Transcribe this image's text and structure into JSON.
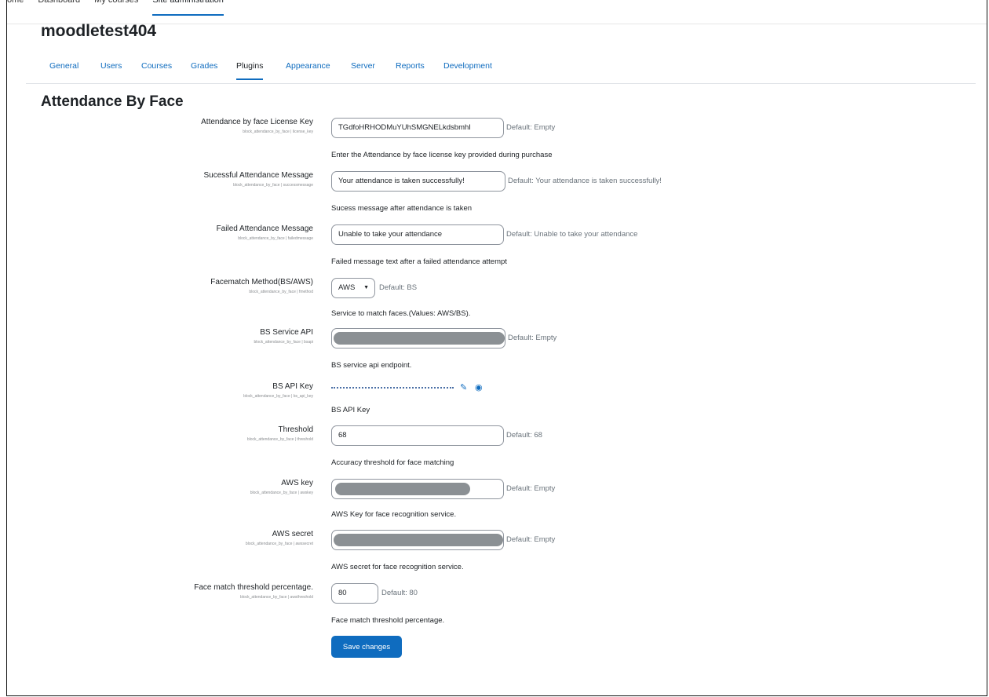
{
  "topnav": [
    "Home",
    "Dashboard",
    "My courses",
    "Site administration"
  ],
  "site_name": "moodletest404",
  "secnav": [
    "General",
    "Users",
    "Courses",
    "Grades",
    "Plugins",
    "Appearance",
    "Server",
    "Reports",
    "Development"
  ],
  "page_title": "Attendance By Face",
  "settings": [
    {
      "label": "Attendance by face License Key",
      "sub": "block_attendance_by_face | license_key",
      "value": "TGdfoHRHODMuYUhSMGNELkdsbmhI",
      "default": "Default: Empty",
      "desc": "Enter the Attendance by face license key provided during purchase"
    },
    {
      "label": "Sucessful Attendance Message",
      "sub": "block_attendance_by_face | successmessage",
      "value": "Your attendance is taken successfully!",
      "default": "Default: Your attendance is taken successfully!",
      "desc": "Sucess message after attendance is taken"
    },
    {
      "label": "Failed Attendance Message",
      "sub": "block_attendance_by_face | failedmessage",
      "value": "Unable to take your attendance",
      "default": "Default: Unable to take your attendance",
      "desc": "Failed message text after a failed attendance attempt"
    },
    {
      "label": "Facematch Method(BS/AWS)",
      "sub": "block_attendance_by_face | fmethod",
      "value": "AWS",
      "default": "Default: BS",
      "desc": "Service to match faces.(Values: AWS/BS)."
    },
    {
      "label": "BS Service API",
      "sub": "block_attendance_by_face | bsapi",
      "value": "",
      "default": "Default: Empty",
      "desc": "BS service api endpoint."
    },
    {
      "label": "BS API Key",
      "sub": "block_attendance_by_face | bs_api_key",
      "value": "",
      "default": "",
      "desc": "BS API Key"
    },
    {
      "label": "Threshold",
      "sub": "block_attendance_by_face | threshold",
      "value": "68",
      "default": "Default: 68",
      "desc": "Accuracy threshold for face matching"
    },
    {
      "label": "AWS key",
      "sub": "block_attendance_by_face | awskey",
      "value": "",
      "default": "Default: Empty",
      "desc": "AWS Key for face recognition service."
    },
    {
      "label": "AWS secret",
      "sub": "block_attendance_by_face | awssecret",
      "value": "",
      "default": "Default: Empty",
      "desc": "AWS secret for face recognition service."
    },
    {
      "label": "Face match threshold percentage.",
      "sub": "block_attendance_by_face | awsthreshold",
      "value": "80",
      "default": "Default: 80",
      "desc": "Face match threshold percentage."
    }
  ],
  "icons": {
    "edit": "pencil-icon",
    "reveal": "eye-icon",
    "select": "caret-down-icon"
  },
  "save_label": "Save changes",
  "colors": {
    "brand": "#0f6cbf",
    "redaction": "#8b9094"
  }
}
